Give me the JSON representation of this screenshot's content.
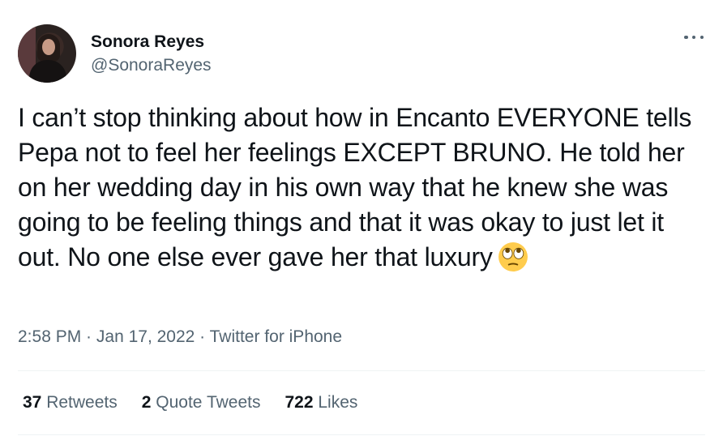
{
  "author": {
    "display_name": "Sonora Reyes",
    "handle": "@SonoraReyes"
  },
  "tweet": {
    "text": "I can’t stop thinking about how in Encanto EVERYONE tells Pepa not to feel her feelings EXCEPT BRUNO. He told her on her wedding day in his own way that he knew she was going to be feeling things and that it was okay to just let it out. No one else ever gave her that luxury",
    "emoji": "face-with-rolling-eyes"
  },
  "meta": {
    "time": "2:58 PM",
    "separator1": " · ",
    "date": "Jan 17, 2022",
    "separator2": " · ",
    "source": "Twitter for iPhone"
  },
  "stats": {
    "retweets": {
      "count": "37",
      "label": "Retweets"
    },
    "quotes": {
      "count": "2",
      "label": "Quote Tweets"
    },
    "likes": {
      "count": "722",
      "label": "Likes"
    }
  },
  "icons": {
    "more": "more-horizontal-icon"
  },
  "colors": {
    "text_primary": "#0f1419",
    "text_secondary": "#536471",
    "divider": "#eff3f4",
    "background": "#ffffff"
  }
}
